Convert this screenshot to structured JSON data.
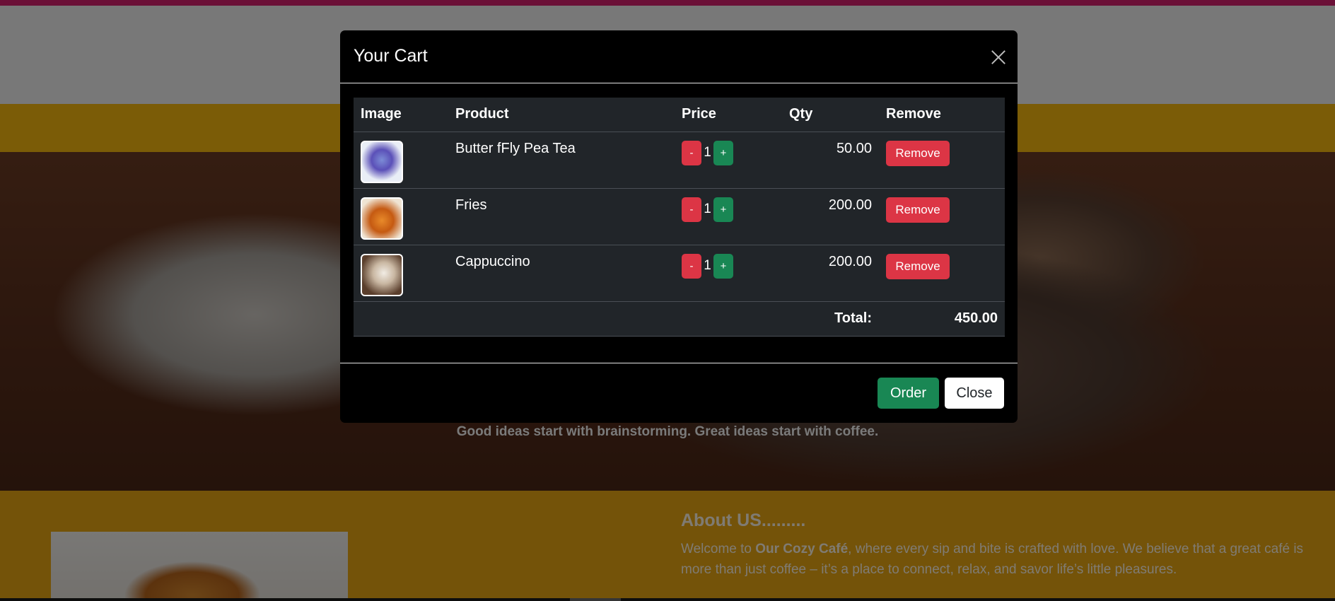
{
  "page": {
    "hero_tagline": "Good ideas start with brainstorming. Great ideas start with coffee.",
    "about_title": "About US.........",
    "about_text_prefix": "Welcome to ",
    "about_text_bold": "Our Cozy Café",
    "about_text_suffix": ", where every sip and bite is crafted with love. We believe that a great café is more than just coffee – it’s a place to connect, relax, and savor life’s little pleasures."
  },
  "modal": {
    "title": "Your Cart",
    "columns": [
      "Image",
      "Product",
      "Price",
      "Qty",
      "Remove"
    ],
    "items": [
      {
        "name": "Butter fFly Pea Tea",
        "qty": "1",
        "price": "50.00",
        "minus_label": "-",
        "plus_label": "+",
        "remove_label": "Remove",
        "image": "butterfly-pea-tea"
      },
      {
        "name": "Fries",
        "qty": "1",
        "price": "200.00",
        "minus_label": "-",
        "plus_label": "+",
        "remove_label": "Remove",
        "image": "fries"
      },
      {
        "name": "Cappuccino",
        "qty": "1",
        "price": "200.00",
        "minus_label": "-",
        "plus_label": "+",
        "remove_label": "Remove",
        "image": "cappuccino"
      }
    ],
    "total_label": "Total:",
    "total_value": "450.00",
    "order_label": "Order",
    "close_label": "Close"
  },
  "colors": {
    "accent_bar": "#d6216f",
    "navbar": "#f6b80f",
    "danger": "#dc3545",
    "success": "#198754"
  }
}
